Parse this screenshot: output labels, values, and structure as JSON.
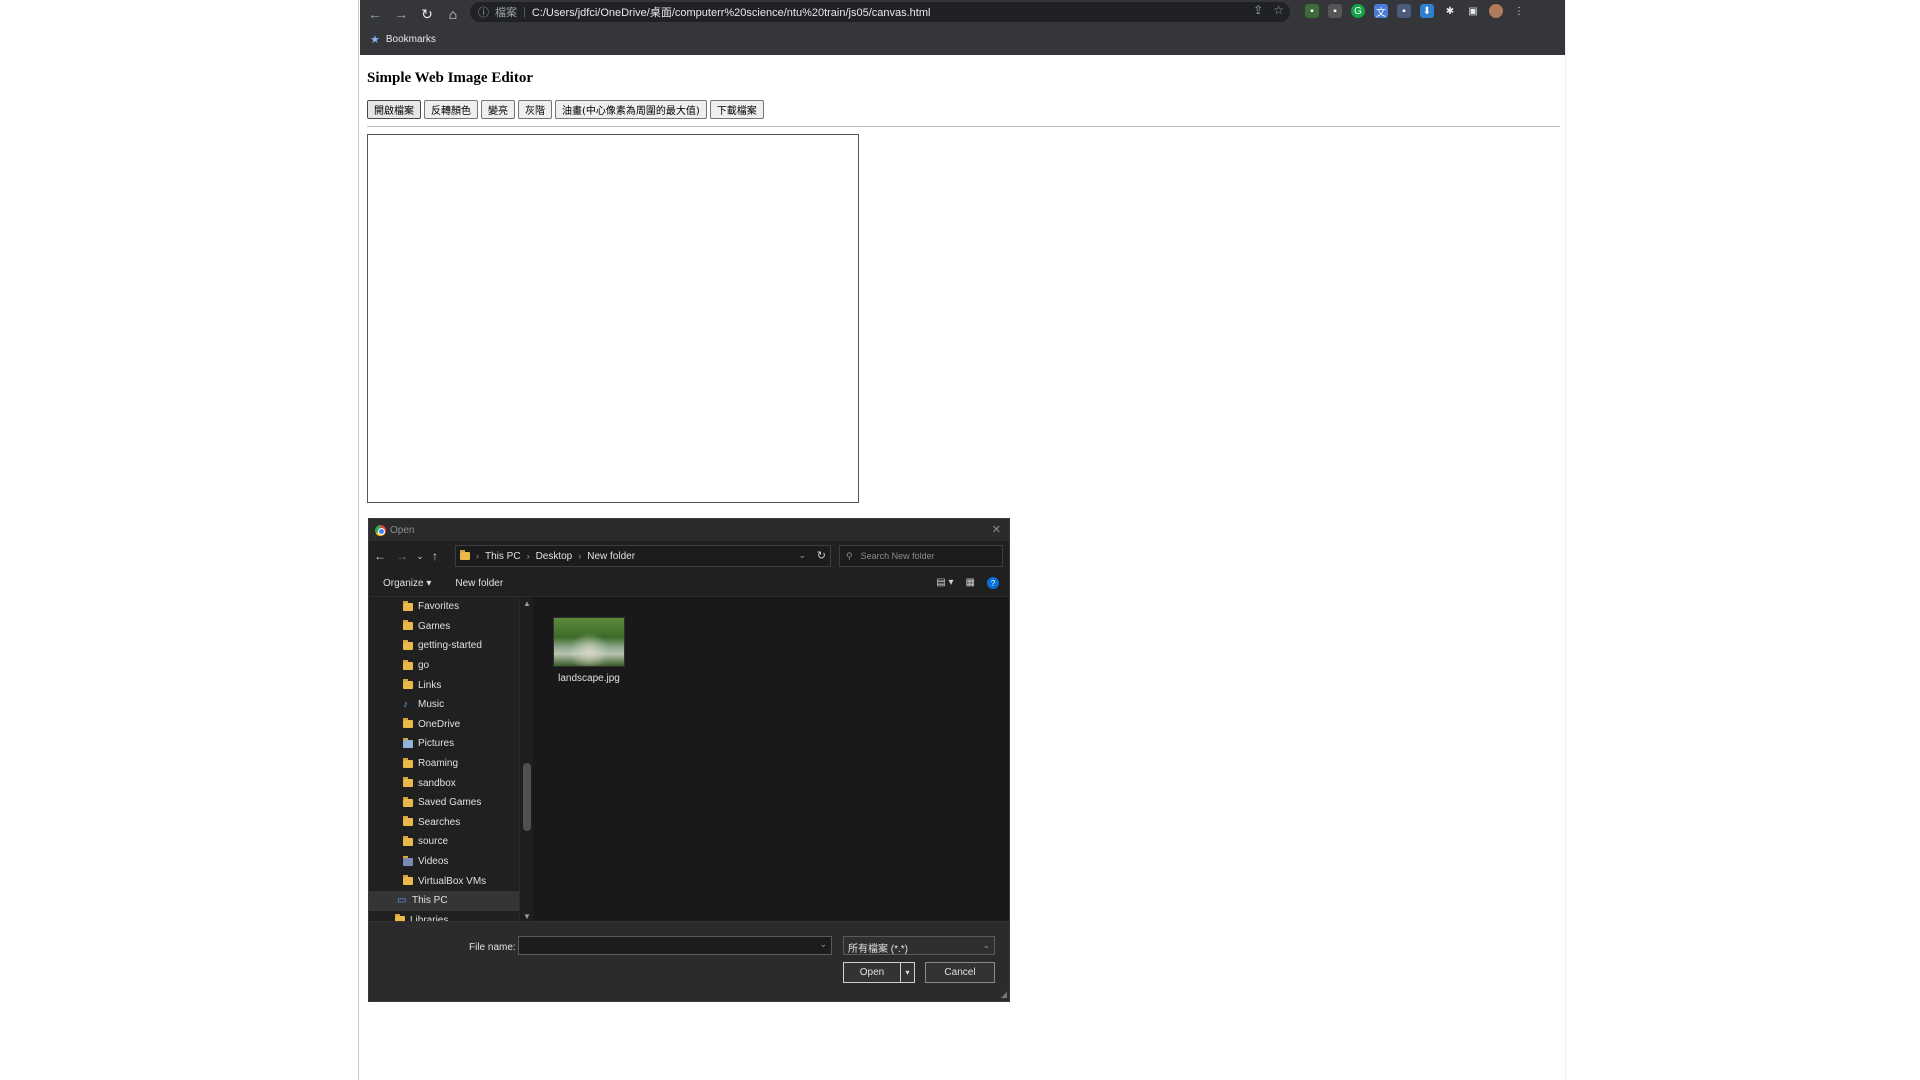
{
  "browser": {
    "url_scheme": "檔案",
    "url": "C:/Users/jdfci/OneDrive/桌面/computerr%20science/ntu%20train/js05/canvas.html",
    "bookmarks_label": "Bookmarks"
  },
  "page": {
    "title": "Simple Web Image Editor",
    "buttons": [
      "開啟檔案",
      "反轉顏色",
      "變亮",
      "灰階",
      "油畫(中心像素為周圍的最大值)",
      "下載檔案"
    ]
  },
  "dialog": {
    "title": "Open",
    "breadcrumb": [
      "This PC",
      "Desktop",
      "New folder"
    ],
    "search_placeholder": "Search New folder",
    "organize_label": "Organize",
    "new_folder_label": "New folder",
    "tree": [
      {
        "label": "Favorites",
        "icon": "folder-star-icon"
      },
      {
        "label": "Games",
        "icon": "folder-icon"
      },
      {
        "label": "getting-started",
        "icon": "folder-icon"
      },
      {
        "label": "go",
        "icon": "folder-icon"
      },
      {
        "label": "Links",
        "icon": "folder-link-icon"
      },
      {
        "label": "Music",
        "icon": "music-icon"
      },
      {
        "label": "OneDrive",
        "icon": "folder-icon"
      },
      {
        "label": "Pictures",
        "icon": "pictures-icon"
      },
      {
        "label": "Roaming",
        "icon": "folder-icon"
      },
      {
        "label": "sandbox",
        "icon": "folder-icon"
      },
      {
        "label": "Saved Games",
        "icon": "folder-icon"
      },
      {
        "label": "Searches",
        "icon": "search-folder-icon"
      },
      {
        "label": "source",
        "icon": "folder-icon"
      },
      {
        "label": "Videos",
        "icon": "videos-icon"
      },
      {
        "label": "VirtualBox VMs",
        "icon": "folder-icon"
      },
      {
        "label": "This PC",
        "icon": "pc-icon"
      },
      {
        "label": "Libraries",
        "icon": "libraries-icon"
      }
    ],
    "files": [
      {
        "name": "landscape.jpg"
      }
    ],
    "file_name_label": "File name:",
    "file_name_value": "",
    "file_type": "所有檔案 (*.*)",
    "open_label": "Open",
    "cancel_label": "Cancel"
  },
  "colors": {
    "chrome_bg": "#35363a",
    "dialog_bg": "#202020",
    "accent": "#0a6fd6",
    "folder": "#e9b949"
  }
}
